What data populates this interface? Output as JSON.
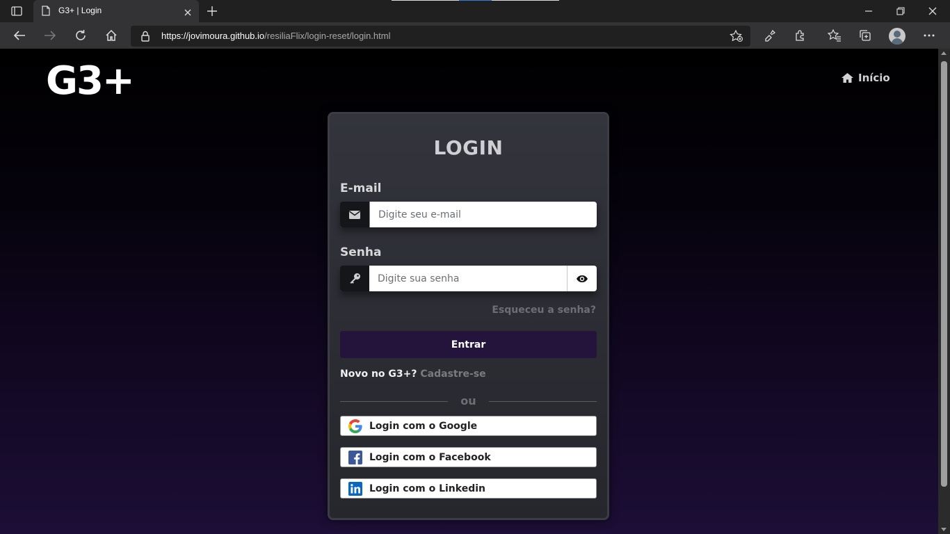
{
  "browser": {
    "tab_title": "G3+ | Login",
    "url_host": "https://jovimoura.github.io",
    "url_path": "/resiliaFlix/login-reset/login.html"
  },
  "header": {
    "logo": "G3+",
    "nav_home_label": "Início"
  },
  "login": {
    "title": "LOGIN",
    "email_label": "E-mail",
    "email_placeholder": "Digite seu e-mail",
    "email_value": "",
    "password_label": "Senha",
    "password_placeholder": "Digite sua senha",
    "password_value": "",
    "forgot_link": "Esqueceu a senha?",
    "submit_label": "Entrar",
    "signup_prompt": "Novo no G3+?",
    "signup_link": "Cadastre-se",
    "divider": "ou",
    "social": [
      {
        "label": "Login com o Google",
        "icon": "google-icon"
      },
      {
        "label": "Login com o Facebook",
        "icon": "facebook-icon"
      },
      {
        "label": "Login com o Linkedin",
        "icon": "linkedin-icon"
      }
    ]
  },
  "colors": {
    "accent": "#24143c",
    "card_background": "#2e2f36",
    "page_gradient_bottom": "#1c0e36"
  }
}
